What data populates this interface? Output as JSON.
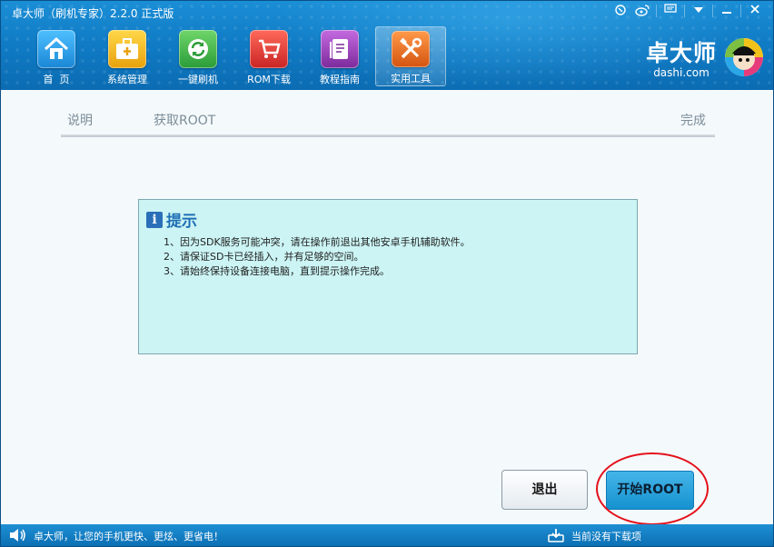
{
  "app": {
    "title": "卓大师（刷机专家）2.2.0 正式版"
  },
  "title_bar_icons": [
    "feedback-icon",
    "weibo-icon",
    "message-icon",
    "menu-dropdown-icon",
    "minimize-icon",
    "close-icon"
  ],
  "nav": {
    "items": [
      {
        "label": "首  页",
        "icon": "home-icon",
        "color": "#2a9fe6"
      },
      {
        "label": "系统管理",
        "icon": "toolbox-icon",
        "color": "#f0b81c"
      },
      {
        "label": "一键刷机",
        "icon": "refresh-icon",
        "color": "#3bb64a"
      },
      {
        "label": "ROM下载",
        "icon": "cart-icon",
        "color": "#e23b3b"
      },
      {
        "label": "教程指南",
        "icon": "book-icon",
        "color": "#9b3fb8"
      },
      {
        "label": "实用工具",
        "icon": "tools-icon",
        "color": "#ea6a1c",
        "active": true
      }
    ]
  },
  "brand": {
    "name": "卓大师",
    "url": "dashi.com"
  },
  "steps": {
    "items": [
      "说明",
      "获取ROOT",
      "完成"
    ]
  },
  "tips": {
    "title": "提示",
    "lines": [
      "1、因为SDK服务可能冲突，请在操作前退出其他安卓手机辅助软件。",
      "2、请保证SD卡已经插入，并有足够的空间。",
      "3、请始终保持设备连接电脑，直到提示操作完成。"
    ]
  },
  "buttons": {
    "exit": "退出",
    "start_root": "开始ROOT"
  },
  "status": {
    "slogan": "卓大师，让您的手机更快、更炫、更省电！",
    "download": "当前没有下载项"
  },
  "colors": {
    "header": "#1383cc",
    "accent": "#1592d0",
    "tips_bg": "#ccf4f4",
    "highlight": "#e4101a"
  }
}
